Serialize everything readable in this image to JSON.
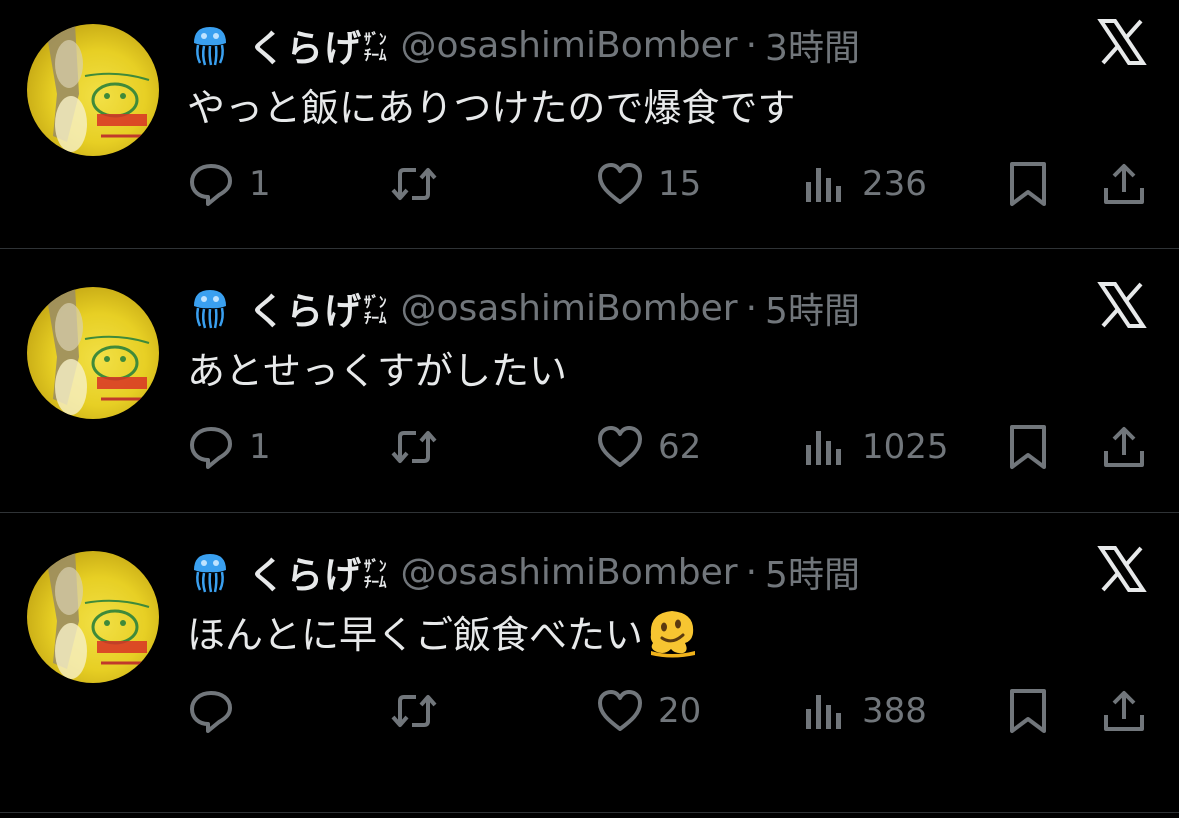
{
  "author": {
    "display_name": "くらげ",
    "name_suffix_line1": "ｻﾞﾝ",
    "name_suffix_line2": "ﾁｰﾑ",
    "handle": "@osashimiBomber",
    "avatar_icon": "yellow-mascot-avatar",
    "name_emoji": "jellyfish-emoji"
  },
  "separator": "·",
  "tweets": [
    {
      "time": "3時間",
      "text": "やっと飯にありつけたので爆食です",
      "trailing_emoji": null,
      "replies": "1",
      "retweets": "",
      "likes": "15",
      "views": "236"
    },
    {
      "time": "5時間",
      "text": "あとせっくすがしたい",
      "trailing_emoji": null,
      "replies": "1",
      "retweets": "",
      "likes": "62",
      "views": "1025"
    },
    {
      "time": "5時間",
      "text": "ほんとに早くご飯食べたい",
      "trailing_emoji": "melting-face-emoji",
      "replies": "",
      "retweets": "",
      "likes": "20",
      "views": "388"
    }
  ],
  "colors": {
    "background": "#000000",
    "text": "#e7e9ea",
    "muted": "#71767b",
    "divider": "#2f3336",
    "avatar_yellow": "#e7cf24"
  }
}
